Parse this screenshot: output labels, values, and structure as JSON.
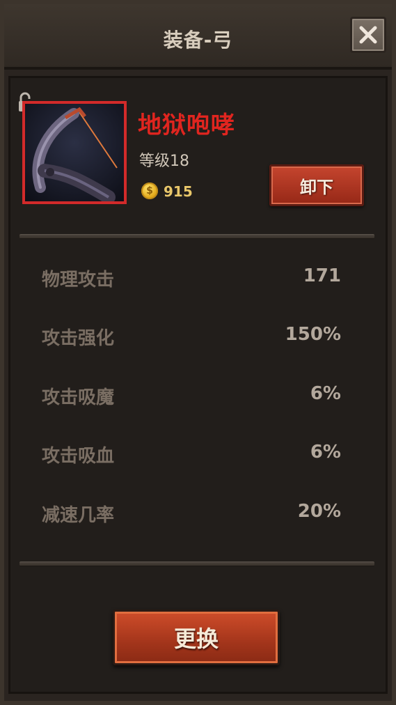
{
  "header": {
    "title": "装备-弓"
  },
  "item": {
    "name": "地狱咆哮",
    "level_text": "等级18",
    "gold": "915",
    "rarity_color": "#e0251f",
    "unequip_label": "卸下"
  },
  "stats": [
    {
      "label": "物理攻击",
      "value": "171"
    },
    {
      "label": "攻击强化",
      "value": "150%"
    },
    {
      "label": "攻击吸魔",
      "value": "6%"
    },
    {
      "label": "攻击吸血",
      "value": "6%"
    },
    {
      "label": "减速几率",
      "value": "20%"
    }
  ],
  "footer": {
    "replace_label": "更换"
  },
  "icons": {
    "close": "close-icon",
    "lock": "lock-icon",
    "item": "bow-icon",
    "currency": "gold-coin-icon"
  }
}
